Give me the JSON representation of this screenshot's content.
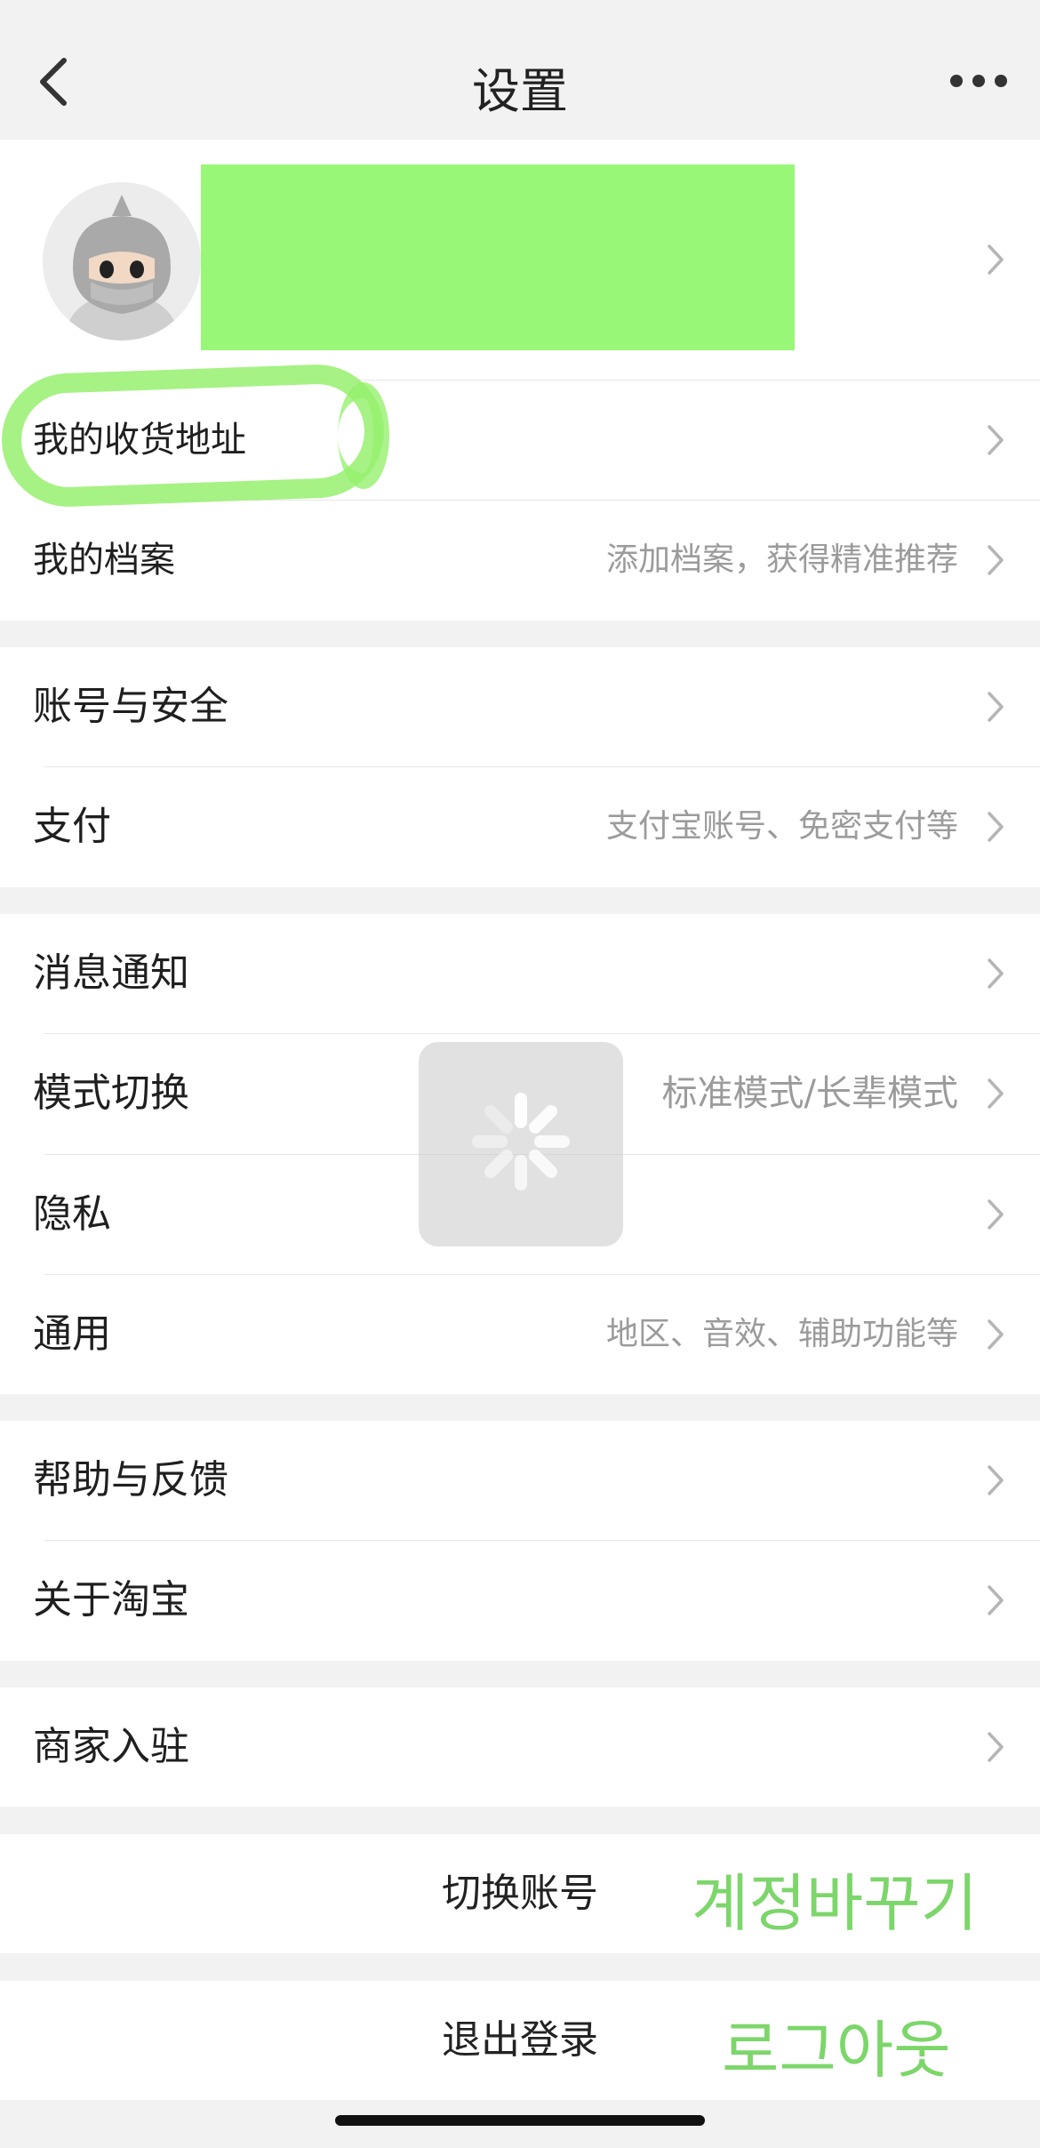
{
  "header": {
    "title": "设置"
  },
  "icons": {
    "back": "chevron-left-icon",
    "more": "more-dots-icon",
    "row_chevron": "chevron-right-icon",
    "loading": "spinner-icon"
  },
  "colors": {
    "redaction": "#99f777",
    "highlight": "#96f06e",
    "annotation_text": "#7cd66a"
  },
  "section1": [
    {
      "label": "我的收货地址",
      "hint": ""
    },
    {
      "label": "我的档案",
      "hint": "添加档案，获得精准推荐"
    }
  ],
  "section2": [
    {
      "label": "账号与安全",
      "hint": ""
    },
    {
      "label": "支付",
      "hint": "支付宝账号、免密支付等"
    }
  ],
  "section3": [
    {
      "label": "消息通知",
      "hint": ""
    },
    {
      "label": "模式切换",
      "hint": "标准模式/长辈模式"
    },
    {
      "label": "隐私",
      "hint": ""
    },
    {
      "label": "通用",
      "hint": "地区、音效、辅助功能等"
    }
  ],
  "section4": [
    {
      "label": "帮助与反馈",
      "hint": ""
    },
    {
      "label": "关于淘宝",
      "hint": ""
    }
  ],
  "section5": [
    {
      "label": "商家入驻",
      "hint": ""
    }
  ],
  "actions": {
    "switch_account": "切换账号",
    "switch_account_note": "계정바꾸기",
    "logout": "退出登录",
    "logout_note": "로그아웃"
  }
}
